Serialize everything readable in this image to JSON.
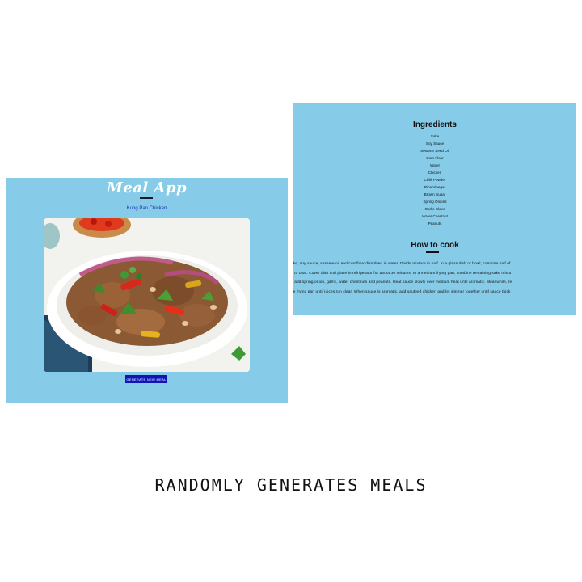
{
  "app": {
    "title": "Meal App",
    "meal_name": "Kung Pao Chicken",
    "button_label": "Generate New Meal",
    "photo": "food-photo"
  },
  "recipe": {
    "ingredients_heading": "Ingredients",
    "ingredients": [
      "Sake",
      "Soy Sauce",
      "Sesame Seed Oil",
      "Corn Flour",
      "Water",
      "Chicken",
      "Chilli Powder",
      "Rice Vinegar",
      "Brown Sugar",
      "Spring Onions",
      "Garlic Clove",
      "Water Chestnut",
      "Peanuts"
    ],
    "how_to_heading": "How to cook",
    "instructions_lines": [
      "ake, soy sauce, sesame oil and cornflour dissolved in water. Divide mixture in half. In a glass dish or bowl, combine half of",
      "n to coat. Cover dish and place in refrigerator for about 30 minutes. In a medium frying pan, combine remaining sake mixtu",
      "d add spring onion, garlic, water chestnuts and peanuts. Heat sauce slowly over medium heat until aromatic. Meanwhile, re",
      "ge frying pan until juices run clear. When sauce is aromatic, add sauteed chicken and let simmer together until sauce thick"
    ]
  },
  "caption": "RANDOMLY GENERATES MEALS",
  "colors": {
    "panel_bg": "#86cbe8",
    "button_bg": "#0d16b8",
    "meal_name": "#1a2fb0"
  }
}
